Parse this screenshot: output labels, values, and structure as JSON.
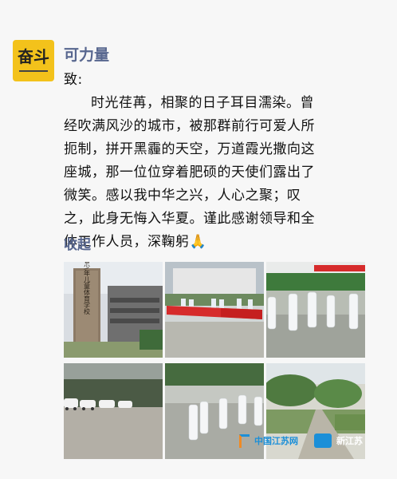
{
  "post": {
    "author": "可力量",
    "greeting": "致:",
    "body_lines": [
      "时光荏苒，相聚的日子耳目濡染。曾",
      "经吹满风沙的城市，被那群前行可爱人所",
      "扼制，拼开黑霾的天空，万道霞光撒向这",
      "座城，那一位位穿着肥硕的天使们露出了",
      "微笑。感以我中华之兴，人心之聚；叹",
      "之，此身无悔入华夏。谨此感谢领导和全",
      "体工作人员，深鞠躬🙏"
    ],
    "collapse_label": "收起"
  },
  "avatar": {
    "text": "奋斗"
  },
  "photos": [
    {
      "id": "building-sign",
      "sign_text": "江苏省少年儿童体育学校"
    },
    {
      "id": "banner-group"
    },
    {
      "id": "hazmat-group-stairs"
    },
    {
      "id": "parking-lot"
    },
    {
      "id": "hazmat-walking"
    },
    {
      "id": "tree-lined-road"
    }
  ],
  "watermark": {
    "left": "中国江苏网",
    "right": "新江苏"
  },
  "colors": {
    "link": "#58678f",
    "avatar_bg": "#f3c21b",
    "banner_red": "#d62b2b"
  }
}
